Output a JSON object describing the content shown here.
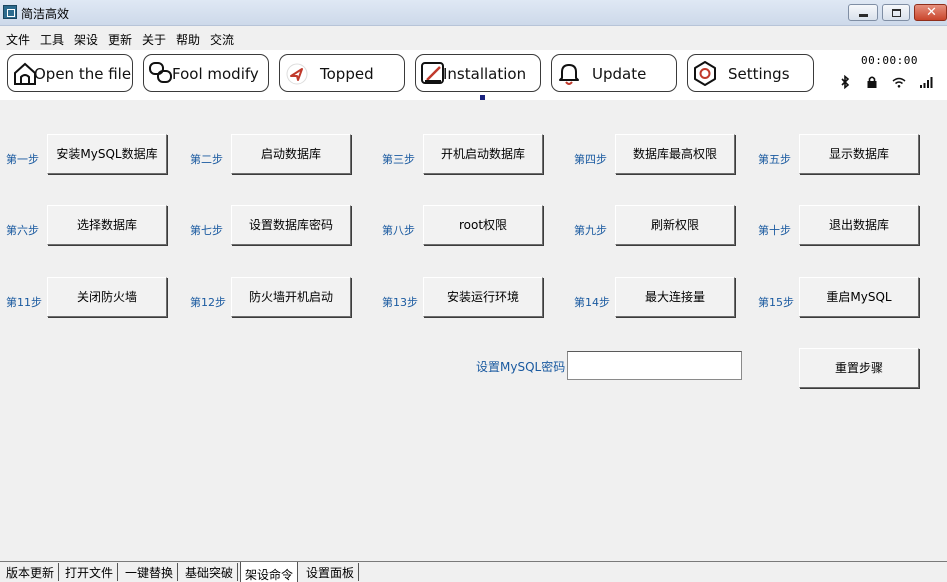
{
  "window": {
    "title": "简洁高效"
  },
  "menu": [
    "文件",
    "工具",
    "架设",
    "更新",
    "关于",
    "帮助",
    "交流"
  ],
  "toolbar": {
    "buttons": [
      {
        "label": "Open the file",
        "icon": "home-icon"
      },
      {
        "label": "Fool modify",
        "icon": "link-icon"
      },
      {
        "label": "Topped",
        "icon": "navigation-arrow-icon"
      },
      {
        "label": "Installation",
        "icon": "edit-box-icon"
      },
      {
        "label": "Update",
        "icon": "bell-icon"
      },
      {
        "label": "Settings",
        "icon": "hexagon-icon"
      }
    ],
    "clock": "00:00:00",
    "status_icons": [
      "bluetooth-icon",
      "lock-icon",
      "wifi-icon",
      "signal-icon"
    ]
  },
  "steps": [
    {
      "label": "第一步",
      "button": "安装MySQL数据库"
    },
    {
      "label": "第二步",
      "button": "启动数据库"
    },
    {
      "label": "第三步",
      "button": "开机启动数据库"
    },
    {
      "label": "第四步",
      "button": "数据库最高权限"
    },
    {
      "label": "第五步",
      "button": "显示数据库"
    },
    {
      "label": "第六步",
      "button": "选择数据库"
    },
    {
      "label": "第七步",
      "button": "设置数据库密码"
    },
    {
      "label": "第八步",
      "button": "root权限"
    },
    {
      "label": "第九步",
      "button": "刷新权限"
    },
    {
      "label": "第十步",
      "button": "退出数据库"
    },
    {
      "label": "第11步",
      "button": "关闭防火墙"
    },
    {
      "label": "第12步",
      "button": "防火墙开机启动"
    },
    {
      "label": "第13步",
      "button": "安装运行环境"
    },
    {
      "label": "第14步",
      "button": "最大连接量"
    },
    {
      "label": "第15步",
      "button": "重启MySQL"
    }
  ],
  "password": {
    "label": "设置MySQL密码",
    "value": ""
  },
  "reset_button": "重置步骤",
  "tabs": [
    {
      "label": "版本更新",
      "active": false
    },
    {
      "label": "打开文件",
      "active": false
    },
    {
      "label": "一键替换",
      "active": false
    },
    {
      "label": "基础突破",
      "active": false
    },
    {
      "label": "架设命令",
      "active": true
    },
    {
      "label": "设置面板",
      "active": false
    }
  ],
  "colors": {
    "step_label": "#1a5aa0",
    "selection_marker": "#1a237e"
  }
}
